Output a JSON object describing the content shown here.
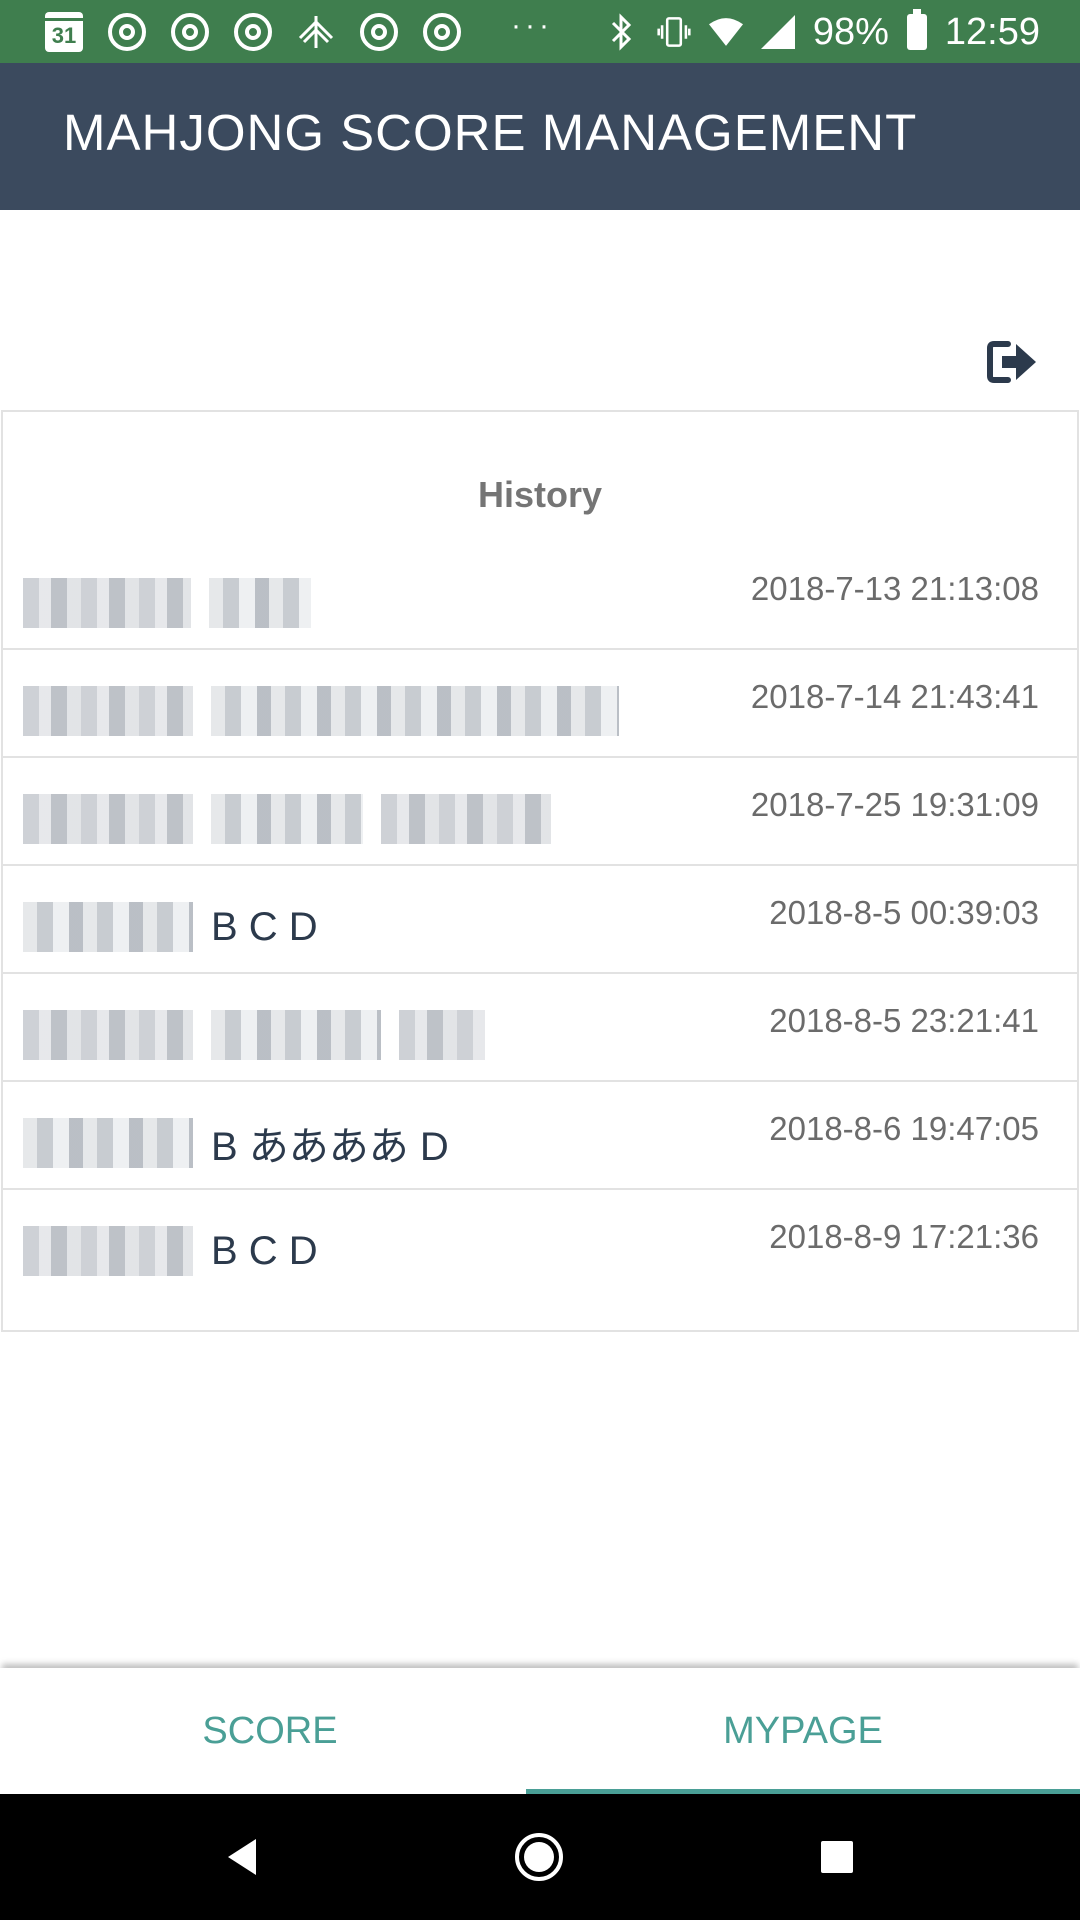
{
  "status_bar": {
    "calendar_day": "31",
    "more_notifications": "···",
    "battery_percent": "98%",
    "time": "12:59"
  },
  "app_bar": {
    "title": "MAHJONG SCORE MANAGEMENT"
  },
  "history": {
    "title": "History",
    "rows": [
      {
        "names_visible": "",
        "timestamp": "2018-7-13 21:13:08"
      },
      {
        "names_visible": "",
        "timestamp": "2018-7-14 21:43:41"
      },
      {
        "names_visible": "",
        "timestamp": "2018-7-25 19:31:09"
      },
      {
        "names_visible": "B C D",
        "timestamp": "2018-8-5 00:39:03"
      },
      {
        "names_visible": "",
        "timestamp": "2018-8-5 23:21:41"
      },
      {
        "names_visible": "B ああああ D",
        "timestamp": "2018-8-6 19:47:05"
      },
      {
        "names_visible": "B C D",
        "timestamp": "2018-8-9 17:21:36"
      }
    ]
  },
  "tabs": [
    {
      "label": "SCORE",
      "selected": false
    },
    {
      "label": "MYPAGE",
      "selected": true
    }
  ],
  "colors": {
    "status_bar": "#3f7e4e",
    "app_bar": "#3b4a5e",
    "accent": "#4a9f96",
    "nav_bar": "#000000"
  },
  "icons": [
    "calendar-icon",
    "chrome-icon",
    "sewing-icon",
    "bluetooth-icon",
    "vibrate-icon",
    "wifi-icon",
    "signal-icon",
    "battery-icon",
    "logout-icon",
    "back-icon",
    "home-icon",
    "recents-icon"
  ]
}
